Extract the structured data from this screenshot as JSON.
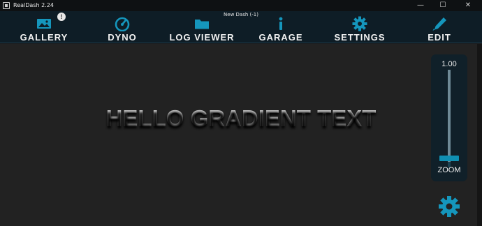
{
  "window": {
    "title": "RealDash 2.24",
    "minimize_glyph": "—",
    "maximize_glyph": "☐",
    "close_glyph": "✕"
  },
  "dash_name": "New Dash (-1)",
  "nav": {
    "badge": "!",
    "items": [
      {
        "label": "GALLERY",
        "icon": "gallery-icon"
      },
      {
        "label": "DYNO",
        "icon": "speedometer-icon"
      },
      {
        "label": "LOG VIEWER",
        "icon": "folder-icon"
      },
      {
        "label": "GARAGE",
        "icon": "info-icon"
      },
      {
        "label": "SETTINGS",
        "icon": "gear-icon"
      },
      {
        "label": "EDIT",
        "icon": "pen-icon"
      }
    ]
  },
  "canvas": {
    "text": "HELLO GRADIENT TEXT"
  },
  "zoom": {
    "value": "1.00",
    "label": "ZOOM",
    "level": 1.0
  },
  "colors": {
    "accent": "#1596bc",
    "nav_bg": "#0e1d26",
    "canvas_bg": "#222222"
  }
}
